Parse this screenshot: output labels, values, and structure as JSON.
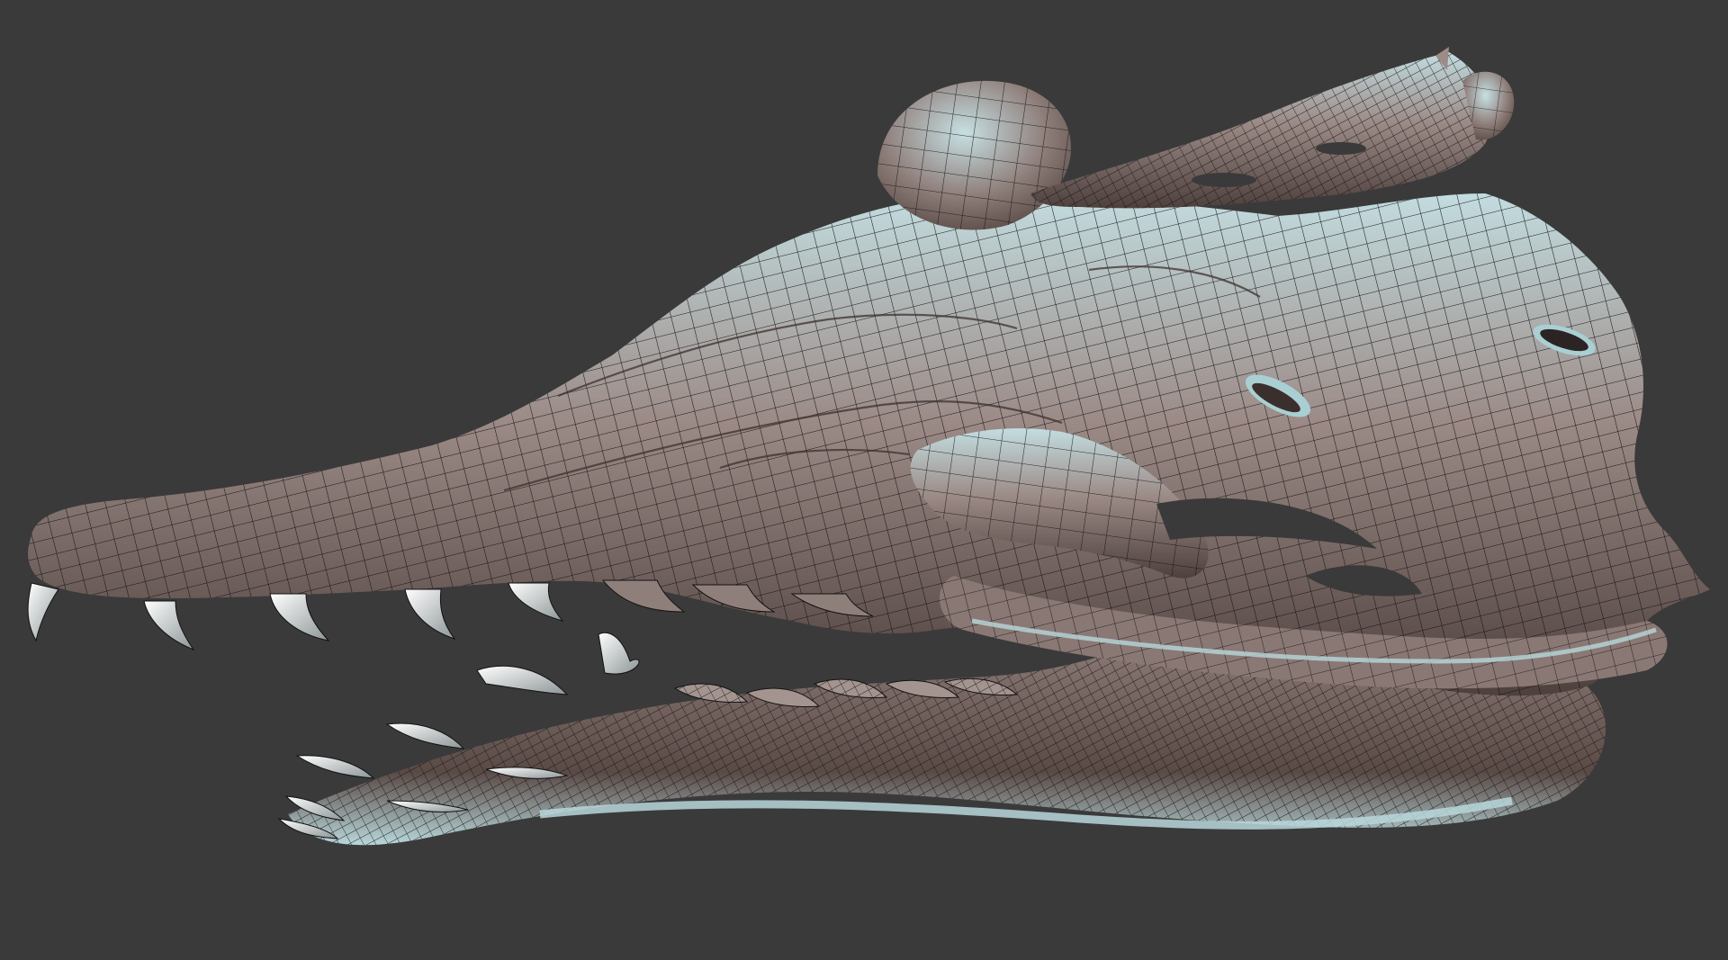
{
  "viewport": {
    "background_color": "#3a3a3a",
    "model": {
      "subject": "skull-mesh",
      "surface_color": "#8f7f7b",
      "highlight_color": "#b8d7da",
      "shadow_color": "#4c3f3c",
      "wire_color": "#121212",
      "teeth_color": "#e2e6e6"
    }
  }
}
